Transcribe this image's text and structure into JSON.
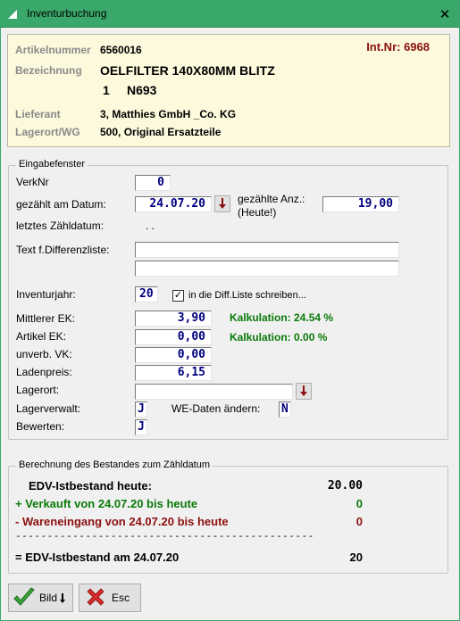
{
  "window": {
    "title": "Inventurbuchung",
    "close_glyph": "✕"
  },
  "article": {
    "artikelnummer_label": "Artikelnummer",
    "artikelnummer": "6560016",
    "int_nr": "Int.Nr: 6968",
    "bezeichnung_label": "Bezeichnung",
    "bezeichnung_line1": "OELFILTER 140X80MM BLITZ",
    "bezeichnung_line2_a": "1",
    "bezeichnung_line2_b": "N693",
    "lieferant_label": "Lieferant",
    "lieferant": "3, Matthies GmbH _Co. KG",
    "lagerort_label": "Lagerort/WG",
    "lagerort": "500, Original Ersatzteile"
  },
  "entry": {
    "legend": "Eingabefenster",
    "verknr_label": "VerkNr",
    "verknr": "0",
    "datum_label": "gezählt am Datum:",
    "datum": "24.07.20",
    "anz_label_1": "gezählte Anz.:",
    "anz_label_2": "(Heute!)",
    "anz": "19,00",
    "letztes_label": "letztes Zähldatum:",
    "letztes_value": ". .",
    "text_label": "Text f.Differenzliste:",
    "text_line1": "",
    "text_line2": "",
    "jahr_label": "Inventurjahr:",
    "jahr": "20",
    "diff_check_label": "in die Diff.Liste schreiben...",
    "diff_check_glyph": "✓",
    "mittlerer_label": "Mittlerer EK:",
    "mittlerer": "3,90",
    "kalk1": "Kalkulation: 24.54 %",
    "artikel_ek_label": "Artikel EK:",
    "artikel_ek": "0,00",
    "kalk2": "Kalkulation: 0.00 %",
    "unverb_label": "unverb. VK:",
    "unverb": "0,00",
    "ladenpreis_label": "Ladenpreis:",
    "ladenpreis": "6,15",
    "lagerort_label": "Lagerort:",
    "lagerort": "",
    "lagerverwalt_label": "Lagerverwalt:",
    "lagerverwalt": "J",
    "we_label": "WE-Daten ändern:",
    "we": "N",
    "bewerten_label": "Bewerten:",
    "bewerten": "J"
  },
  "calc": {
    "legend": "Berechnung des Bestandes zum Zähldatum",
    "ist_label": "EDV-Istbestand heute:",
    "ist_value": "20.00",
    "verkauft_label": "+ Verkauft von 24.07.20 bis heute",
    "verkauft_value": "0",
    "wareneingang_label": "- Wareneingang von 24.07.20 bis heute",
    "wareneingang_value": "0",
    "divider": "-----------------------------------------------",
    "result_label": "= EDV-Istbestand am 24.07.20",
    "result_value": "20"
  },
  "buttons": {
    "bild": "Bild",
    "esc": "Esc"
  },
  "colors": {
    "titlebar": "#3aa86a",
    "info_bg": "#fcf9dc",
    "value_blue": "#000080",
    "green": "#0a7a0a",
    "dark_red": "#8c0f0f"
  }
}
